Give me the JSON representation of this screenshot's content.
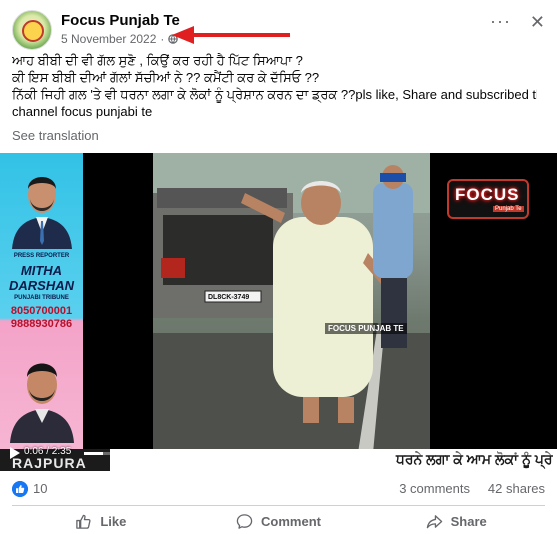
{
  "post": {
    "page_name": "Focus Punjab Te",
    "date": "5 November 2022",
    "date_separator": "·",
    "text_lines": [
      "ਆਹ ਬੀਬੀ ਦੀ ਵੀ ਗੱਲ ਸੁਣੋ , ਕਿਉਂ ਕਰ ਰਹੀ ਹੈ ਪਿੱਟ ਸਿਆਪਾ ?",
      "ਕੀ ਇਸ ਬੀਬੀ ਦੀਆਂ ਗੱਲਾਂ ਸੱਚੀਆਂ ਨੇ ?? ਕਮੈਂਟੀ ਕਰ ਕੇ ਦੱਸਿਓ ??",
      "ਨਿੱਕੀ ਜਿਹੀ ਗਲ 'ਤੇ ਵੀ ਧਰਨਾ ਲਗਾ ਕੇ ਲੋਕਾਂ ਨੂੰ ਪ੍ਰੇਸ਼ਾਨ ਕਰਨ ਦਾ ਡ੍ਰਕ ??pls like, Share and subscribed this",
      "channel focus punjabi te"
    ],
    "see_translation": "See translation"
  },
  "video": {
    "reporter_title": "PRESS REPORTER",
    "reporter_name_line1": "MITHA",
    "reporter_name_line2": "DARSHAN",
    "reporter_paper": "PUNJABI TRIBUNE",
    "reporter_phone1": "8050700001",
    "reporter_phone2": "9888930786",
    "scene_watermark": "FOCUS PUNJAB TE",
    "car_plate": "DL8CK-3749",
    "logo_word": "FOCUS",
    "logo_sub": "Punjab Te",
    "timecode": "0:06 / 2:35",
    "progress": 0.04,
    "location": "RAJPURA",
    "ticker_text": "ਧਰਨੇ ਲਗਾ ਕੇ ਆਮ ਲੋਕਾਂ ਨੂੰ ਪ੍ਰੇ"
  },
  "stats": {
    "likes": "10",
    "comments": "3 comments",
    "shares": "42 shares"
  },
  "actions": {
    "like": "Like",
    "comment": "Comment",
    "share": "Share"
  },
  "colors": {
    "accent": "#1877f2",
    "arrow": "#e02020",
    "secondary_text": "#65676b"
  }
}
